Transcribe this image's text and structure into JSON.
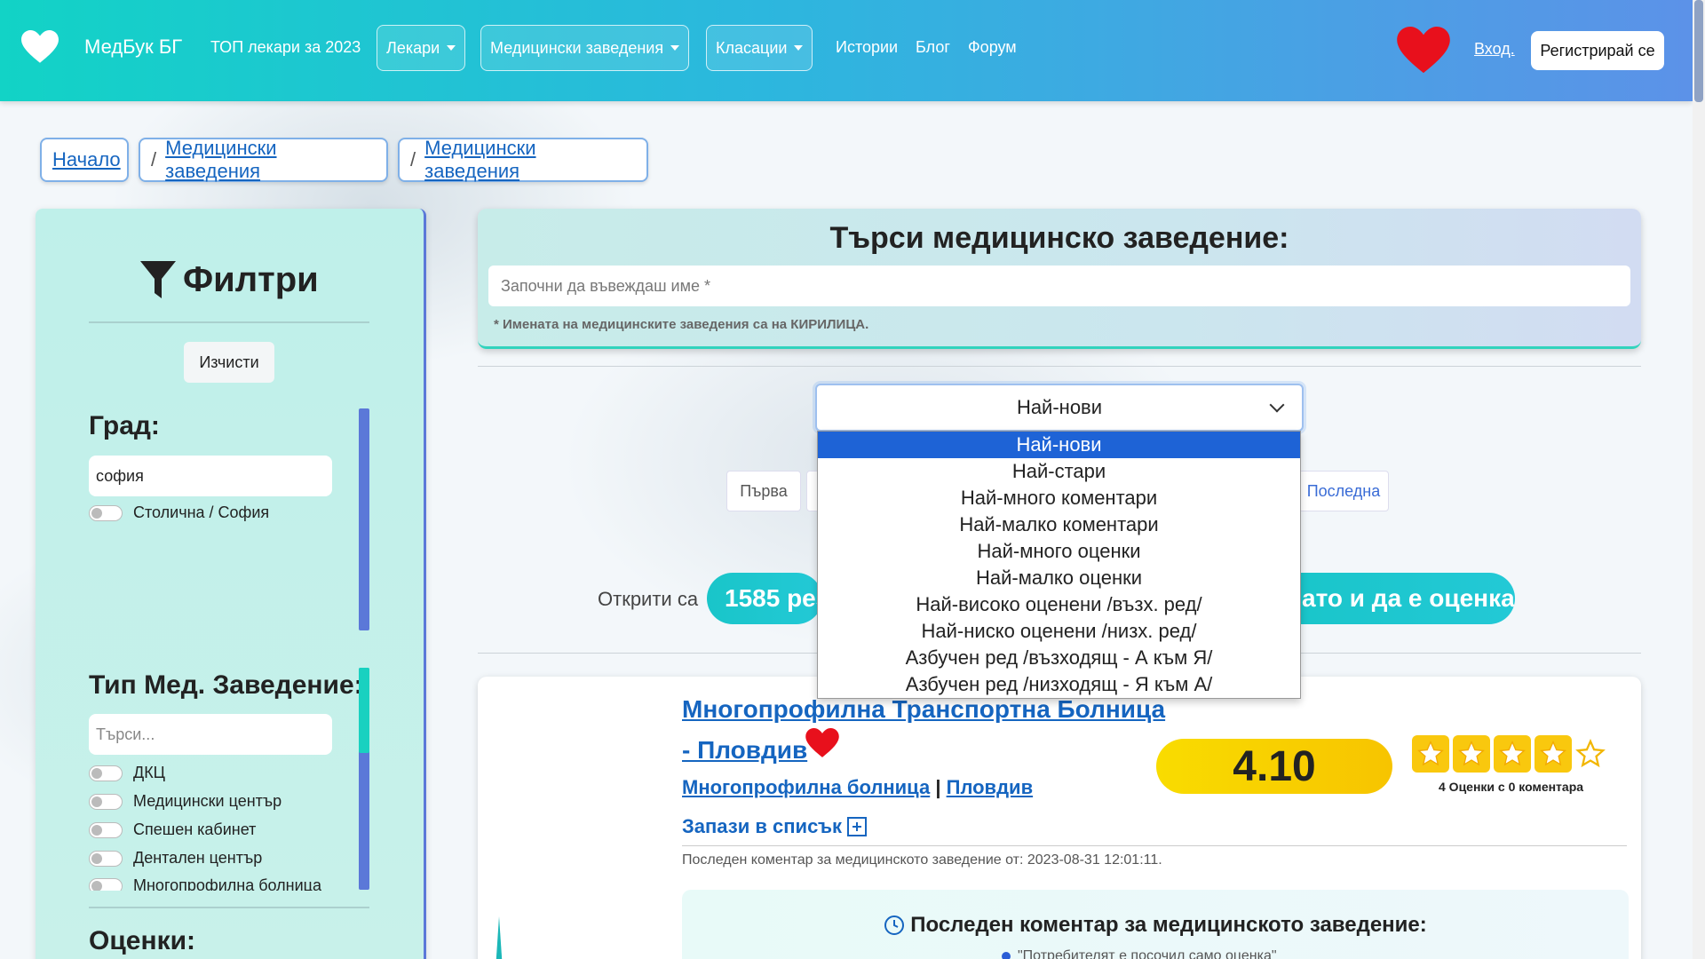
{
  "header": {
    "brand": "МедБук БГ",
    "top_doctors": "ТОП лекари за 2023",
    "nav_doctors": "Лекари",
    "nav_facilities": "Медицински заведения",
    "nav_rankings": "Класации",
    "nav_stories": "Истории",
    "nav_blog": "Блог",
    "nav_forum": "Форум",
    "login": "Вход.",
    "register": "Регистрирай се"
  },
  "breadcrumbs": {
    "home": "Начало",
    "facilities_1": "Медицински заведения",
    "facilities_2": "Медицински заведения",
    "sep": "/"
  },
  "sidebar": {
    "title": "Филтри",
    "clear": "Изчисти",
    "city_label": "Град:",
    "city_value": "софия",
    "city_option": "Столична / София",
    "type_label": "Тип Мед. Заведение:",
    "type_search_placeholder": "Търси...",
    "types": [
      "ДКЦ",
      "Медицински център",
      "Спешен кабинет",
      "Дентален център",
      "Многопрофилна болница"
    ],
    "ratings_label": "Оценки:"
  },
  "search": {
    "title": "Търси медицинско заведение:",
    "placeholder": "Започни да въвеждаш име *",
    "note": "* Имената на медицинските заведения са на КИРИЛИЦА."
  },
  "sort": {
    "selected": "Най-нови",
    "options": [
      "Най-нови",
      "Най-стари",
      "Най-много коментари",
      "Най-малко коментари",
      "Най-много оценки",
      "Най-малко оценки",
      "Най-високо оценени /възх. ред/",
      "Най-ниско оценени /низх. ред/",
      "Азбучен ред /възходящ - А към Я/",
      "Азбучен ред /низходящ - Я към А/"
    ]
  },
  "pagination": {
    "first": "Първа",
    "last": "Последна"
  },
  "results": {
    "found_prefix": "Открити са",
    "found_pill_left": "1585 рез",
    "found_pill_right": "ато и да е оценка"
  },
  "result_card": {
    "title": "Многопрофилна Транспортна Болница - Пловдив",
    "type": "Многопрофилна болница",
    "divider": "|",
    "city": "Пловдив",
    "save": "Запази в списък",
    "last_comment_date": "Последен коментар за медицинското заведение от: 2023-08-31 12:01:11.",
    "rating": "4.10",
    "stars_full": 4,
    "stars_total": 5,
    "ratings_count": "4 Оценки с 0 коментара",
    "last_comment_heading": "Последен коментар за медицинското заведение:",
    "comment_snippet": "\"Потребителят е посочил само оценка\""
  },
  "colors": {
    "header_start": "#12d3c6",
    "header_end": "#5c92e8",
    "link": "#1565c0",
    "rating": "#f9dc00",
    "heart": "#e8101c",
    "selected_option": "#1e63d6"
  }
}
